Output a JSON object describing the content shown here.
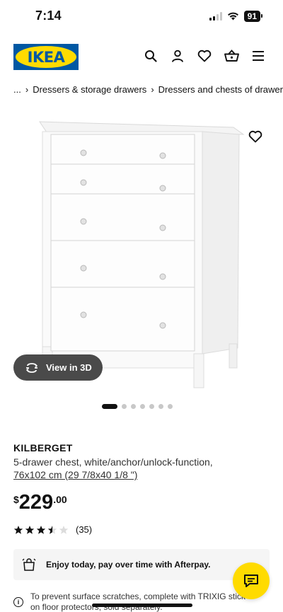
{
  "status": {
    "time": "7:14",
    "battery": "91"
  },
  "header": {
    "logo_text": "IKEA",
    "brand_colors": {
      "blue": "#0058a3",
      "yellow": "#ffdb00"
    },
    "icons": [
      "search-icon",
      "account-icon",
      "heart-icon",
      "basket-icon",
      "menu-icon"
    ]
  },
  "breadcrumb": {
    "ellipsis": "...",
    "sep": "›",
    "items": [
      "Dressers & storage drawers",
      "Dressers and chests of drawers"
    ]
  },
  "product": {
    "name": "KILBERGET",
    "description": "5-drawer chest, white/anchor/unlock-function,",
    "size": "76x102 cm (29 7/8x40 1/8 \")",
    "price": {
      "currency": "$",
      "whole": "229",
      "decimals": ".00"
    },
    "rating": {
      "stars": 3.5,
      "count": "(35)"
    },
    "view3d_label": "View in 3D",
    "carousel": {
      "total": 7,
      "active": 0
    }
  },
  "afterpay": {
    "text": "Enjoy today, pay over time with Afterpay."
  },
  "info_note": {
    "icon": "i",
    "text": "To prevent surface scratches, complete with TRIXIG stick-on floor protectors, sold separately."
  }
}
